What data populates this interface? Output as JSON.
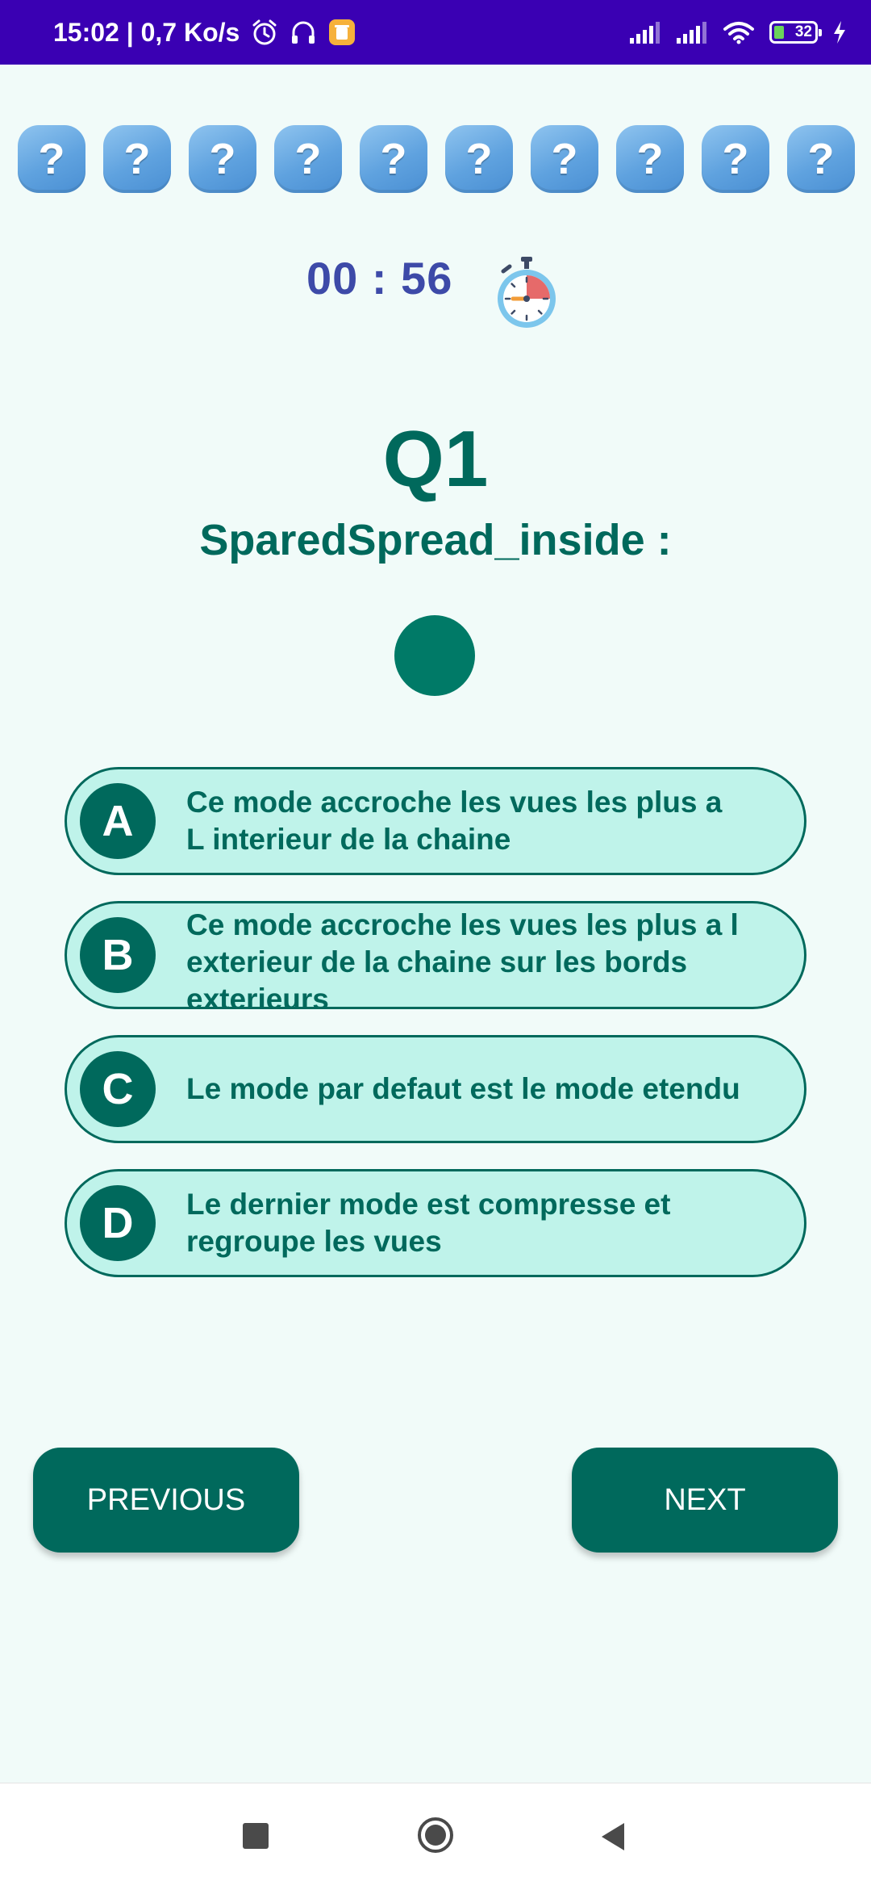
{
  "status_bar": {
    "time_speed": "15:02 | 0,7 Ko/s",
    "battery": "32",
    "icons": [
      "alarm-icon",
      "headphones-icon",
      "notification-app-icon",
      "signal-icon",
      "signal-icon",
      "wifi-icon",
      "battery-icon",
      "charging-icon"
    ]
  },
  "progress": {
    "tiles": [
      "?",
      "?",
      "?",
      "?",
      "?",
      "?",
      "?",
      "?",
      "?",
      "?"
    ]
  },
  "timer": {
    "text": "00 : 56",
    "icon": "stopwatch-icon"
  },
  "question": {
    "number": "Q1",
    "text": "SparedSpread_inside :"
  },
  "options": [
    {
      "letter": "A",
      "text": "Ce mode accroche les vues les plus a L interieur de la chaine"
    },
    {
      "letter": "B",
      "text": "Ce mode accroche les vues les plus a l exterieur de la chaine sur les bords exterieurs"
    },
    {
      "letter": "C",
      "text": "Le mode par defaut est le mode etendu"
    },
    {
      "letter": "D",
      "text": "Le dernier mode est compresse et regroupe les vues"
    }
  ],
  "navigation": {
    "previous_label": "PREVIOUS",
    "next_label": "NEXT"
  },
  "colors": {
    "status_bar": "#3a00b3",
    "primary": "#00695c",
    "option_bg": "#bff3ea",
    "timer": "#3d4aa8",
    "tile": "#5fa2df",
    "background": "#f1fbf9"
  }
}
